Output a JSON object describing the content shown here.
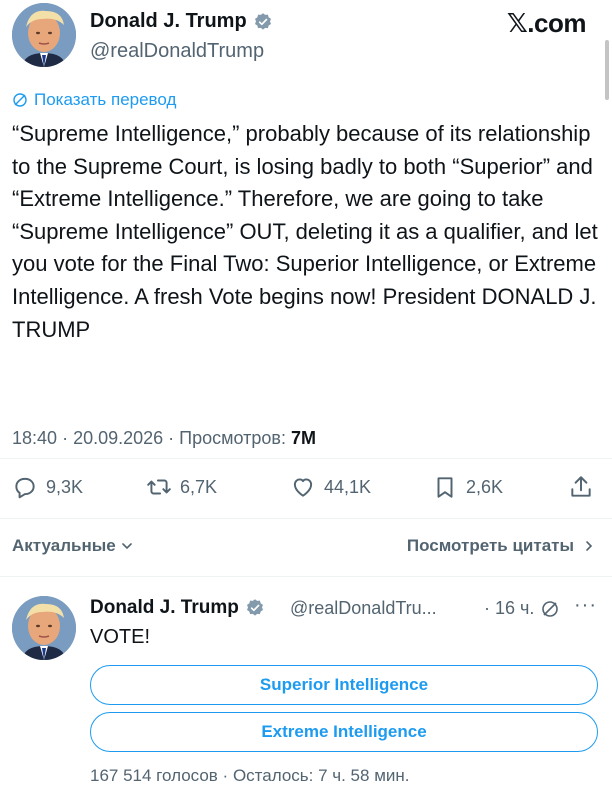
{
  "author": {
    "name": "Donald J. Trump",
    "handle": "@realDonaldTrump"
  },
  "brand": "𝕏.com",
  "translate_label": "Показать перевод",
  "tweet": {
    "text": "“Supreme Intelligence,” probably because of its relationship to the Supreme Court, is losing badly to both “Superior” and “Extreme Intelligence.” Therefore, we are going to take “Supreme Intelligence” OUT, deleting it as a qualifier, and let you vote for the Final Two: Superior Intelligence, or Extreme Intelligence. A fresh Vote begins now! President DONALD J. TRUMP",
    "time": "18:40",
    "date": "20.09.2026",
    "views_label": "Просмотров:",
    "views_count": "7M"
  },
  "actions": {
    "replies": "9,3K",
    "retweets": "6,7K",
    "likes": "44,1K",
    "bookmarks": "2,6K"
  },
  "sort": {
    "relevance_label": "Актуальные",
    "quotes_label": "Посмотреть цитаты"
  },
  "reply": {
    "name": "Donald J. Trump",
    "handle": "@realDonaldTru...",
    "time": "16 ч.",
    "text": "VOTE!",
    "poll_options": [
      "Superior Intelligence",
      "Extreme Intelligence"
    ],
    "poll_votes": "167 514 голосов",
    "poll_remaining": "Осталось: 7 ч. 58 мин."
  },
  "colors": {
    "accent": "#1d9bf0",
    "secondary_text": "#536471",
    "primary_text": "#0f1419"
  }
}
